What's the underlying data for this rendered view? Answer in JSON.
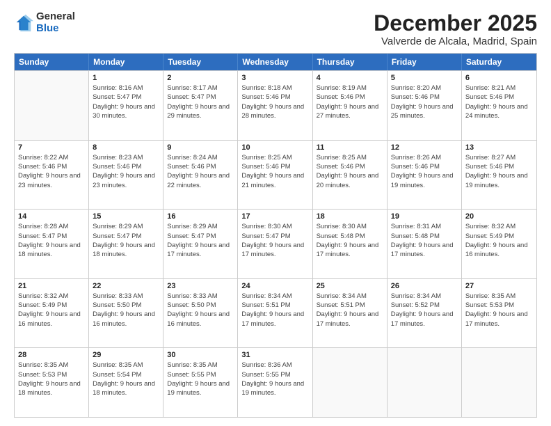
{
  "logo": {
    "general": "General",
    "blue": "Blue"
  },
  "title": "December 2025",
  "subtitle": "Valverde de Alcala, Madrid, Spain",
  "headers": [
    "Sunday",
    "Monday",
    "Tuesday",
    "Wednesday",
    "Thursday",
    "Friday",
    "Saturday"
  ],
  "rows": [
    [
      {
        "day": "",
        "empty": true
      },
      {
        "day": "1",
        "sunrise": "Sunrise: 8:16 AM",
        "sunset": "Sunset: 5:47 PM",
        "daylight": "Daylight: 9 hours and 30 minutes."
      },
      {
        "day": "2",
        "sunrise": "Sunrise: 8:17 AM",
        "sunset": "Sunset: 5:47 PM",
        "daylight": "Daylight: 9 hours and 29 minutes."
      },
      {
        "day": "3",
        "sunrise": "Sunrise: 8:18 AM",
        "sunset": "Sunset: 5:46 PM",
        "daylight": "Daylight: 9 hours and 28 minutes."
      },
      {
        "day": "4",
        "sunrise": "Sunrise: 8:19 AM",
        "sunset": "Sunset: 5:46 PM",
        "daylight": "Daylight: 9 hours and 27 minutes."
      },
      {
        "day": "5",
        "sunrise": "Sunrise: 8:20 AM",
        "sunset": "Sunset: 5:46 PM",
        "daylight": "Daylight: 9 hours and 25 minutes."
      },
      {
        "day": "6",
        "sunrise": "Sunrise: 8:21 AM",
        "sunset": "Sunset: 5:46 PM",
        "daylight": "Daylight: 9 hours and 24 minutes."
      }
    ],
    [
      {
        "day": "7",
        "sunrise": "Sunrise: 8:22 AM",
        "sunset": "Sunset: 5:46 PM",
        "daylight": "Daylight: 9 hours and 23 minutes."
      },
      {
        "day": "8",
        "sunrise": "Sunrise: 8:23 AM",
        "sunset": "Sunset: 5:46 PM",
        "daylight": "Daylight: 9 hours and 23 minutes."
      },
      {
        "day": "9",
        "sunrise": "Sunrise: 8:24 AM",
        "sunset": "Sunset: 5:46 PM",
        "daylight": "Daylight: 9 hours and 22 minutes."
      },
      {
        "day": "10",
        "sunrise": "Sunrise: 8:25 AM",
        "sunset": "Sunset: 5:46 PM",
        "daylight": "Daylight: 9 hours and 21 minutes."
      },
      {
        "day": "11",
        "sunrise": "Sunrise: 8:25 AM",
        "sunset": "Sunset: 5:46 PM",
        "daylight": "Daylight: 9 hours and 20 minutes."
      },
      {
        "day": "12",
        "sunrise": "Sunrise: 8:26 AM",
        "sunset": "Sunset: 5:46 PM",
        "daylight": "Daylight: 9 hours and 19 minutes."
      },
      {
        "day": "13",
        "sunrise": "Sunrise: 8:27 AM",
        "sunset": "Sunset: 5:46 PM",
        "daylight": "Daylight: 9 hours and 19 minutes."
      }
    ],
    [
      {
        "day": "14",
        "sunrise": "Sunrise: 8:28 AM",
        "sunset": "Sunset: 5:47 PM",
        "daylight": "Daylight: 9 hours and 18 minutes."
      },
      {
        "day": "15",
        "sunrise": "Sunrise: 8:29 AM",
        "sunset": "Sunset: 5:47 PM",
        "daylight": "Daylight: 9 hours and 18 minutes."
      },
      {
        "day": "16",
        "sunrise": "Sunrise: 8:29 AM",
        "sunset": "Sunset: 5:47 PM",
        "daylight": "Daylight: 9 hours and 17 minutes."
      },
      {
        "day": "17",
        "sunrise": "Sunrise: 8:30 AM",
        "sunset": "Sunset: 5:47 PM",
        "daylight": "Daylight: 9 hours and 17 minutes."
      },
      {
        "day": "18",
        "sunrise": "Sunrise: 8:30 AM",
        "sunset": "Sunset: 5:48 PM",
        "daylight": "Daylight: 9 hours and 17 minutes."
      },
      {
        "day": "19",
        "sunrise": "Sunrise: 8:31 AM",
        "sunset": "Sunset: 5:48 PM",
        "daylight": "Daylight: 9 hours and 17 minutes."
      },
      {
        "day": "20",
        "sunrise": "Sunrise: 8:32 AM",
        "sunset": "Sunset: 5:49 PM",
        "daylight": "Daylight: 9 hours and 16 minutes."
      }
    ],
    [
      {
        "day": "21",
        "sunrise": "Sunrise: 8:32 AM",
        "sunset": "Sunset: 5:49 PM",
        "daylight": "Daylight: 9 hours and 16 minutes."
      },
      {
        "day": "22",
        "sunrise": "Sunrise: 8:33 AM",
        "sunset": "Sunset: 5:50 PM",
        "daylight": "Daylight: 9 hours and 16 minutes."
      },
      {
        "day": "23",
        "sunrise": "Sunrise: 8:33 AM",
        "sunset": "Sunset: 5:50 PM",
        "daylight": "Daylight: 9 hours and 16 minutes."
      },
      {
        "day": "24",
        "sunrise": "Sunrise: 8:34 AM",
        "sunset": "Sunset: 5:51 PM",
        "daylight": "Daylight: 9 hours and 17 minutes."
      },
      {
        "day": "25",
        "sunrise": "Sunrise: 8:34 AM",
        "sunset": "Sunset: 5:51 PM",
        "daylight": "Daylight: 9 hours and 17 minutes."
      },
      {
        "day": "26",
        "sunrise": "Sunrise: 8:34 AM",
        "sunset": "Sunset: 5:52 PM",
        "daylight": "Daylight: 9 hours and 17 minutes."
      },
      {
        "day": "27",
        "sunrise": "Sunrise: 8:35 AM",
        "sunset": "Sunset: 5:53 PM",
        "daylight": "Daylight: 9 hours and 17 minutes."
      }
    ],
    [
      {
        "day": "28",
        "sunrise": "Sunrise: 8:35 AM",
        "sunset": "Sunset: 5:53 PM",
        "daylight": "Daylight: 9 hours and 18 minutes."
      },
      {
        "day": "29",
        "sunrise": "Sunrise: 8:35 AM",
        "sunset": "Sunset: 5:54 PM",
        "daylight": "Daylight: 9 hours and 18 minutes."
      },
      {
        "day": "30",
        "sunrise": "Sunrise: 8:35 AM",
        "sunset": "Sunset: 5:55 PM",
        "daylight": "Daylight: 9 hours and 19 minutes."
      },
      {
        "day": "31",
        "sunrise": "Sunrise: 8:36 AM",
        "sunset": "Sunset: 5:55 PM",
        "daylight": "Daylight: 9 hours and 19 minutes."
      },
      {
        "day": "",
        "empty": true
      },
      {
        "day": "",
        "empty": true
      },
      {
        "day": "",
        "empty": true
      }
    ]
  ]
}
